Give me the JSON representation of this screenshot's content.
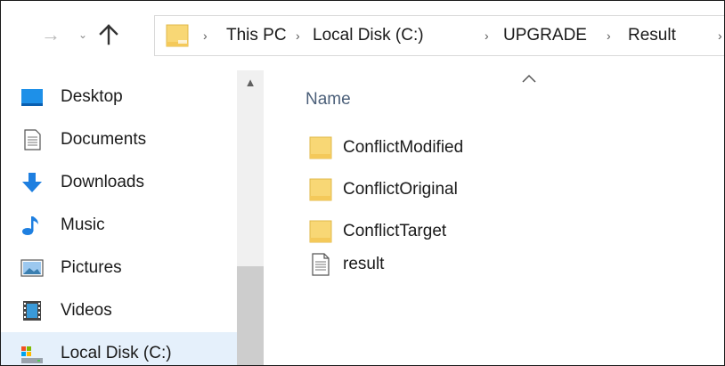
{
  "address": {
    "crumbs": [
      "This PC",
      "Local Disk (C:)",
      "UPGRADE",
      "Result"
    ]
  },
  "nav": {
    "items": [
      {
        "label": "Desktop",
        "icon": "desktop-icon"
      },
      {
        "label": "Documents",
        "icon": "documents-icon"
      },
      {
        "label": "Downloads",
        "icon": "downloads-icon"
      },
      {
        "label": "Music",
        "icon": "music-icon"
      },
      {
        "label": "Pictures",
        "icon": "pictures-icon"
      },
      {
        "label": "Videos",
        "icon": "videos-icon"
      },
      {
        "label": "Local Disk (C:)",
        "icon": "local-disk-icon"
      }
    ]
  },
  "content": {
    "column_name": "Name",
    "files": [
      {
        "name": "ConflictModified",
        "type": "folder"
      },
      {
        "name": "ConflictOriginal",
        "type": "folder"
      },
      {
        "name": "ConflictTarget",
        "type": "folder"
      },
      {
        "name": "result",
        "type": "file"
      }
    ]
  },
  "colors": {
    "folder": "#f8d775",
    "selection": "#e5f0fb",
    "column_header": "#4c607a"
  }
}
